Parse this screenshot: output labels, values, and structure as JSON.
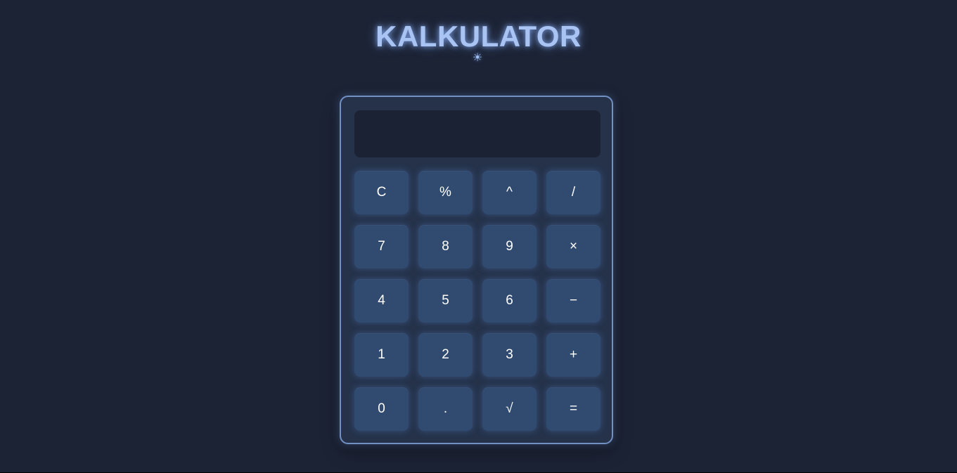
{
  "header": {
    "title": "KALKULATOR",
    "theme_icon": "sun-icon",
    "theme_glyph": "☀"
  },
  "display": {
    "value": ""
  },
  "keys": {
    "clear": "C",
    "percent": "%",
    "power": "^",
    "divide": "/",
    "seven": "7",
    "eight": "8",
    "nine": "9",
    "multiply": "×",
    "four": "4",
    "five": "5",
    "six": "6",
    "subtract": "−",
    "one": "1",
    "two": "2",
    "three": "3",
    "add": "+",
    "zero": "0",
    "decimal": ".",
    "sqrt": "√",
    "equals": "="
  },
  "colors": {
    "background": "#1c2335",
    "title": "#a9c4f3",
    "calculator_border": "#7190c4",
    "key": "#304a70",
    "display": "#1b2234"
  }
}
